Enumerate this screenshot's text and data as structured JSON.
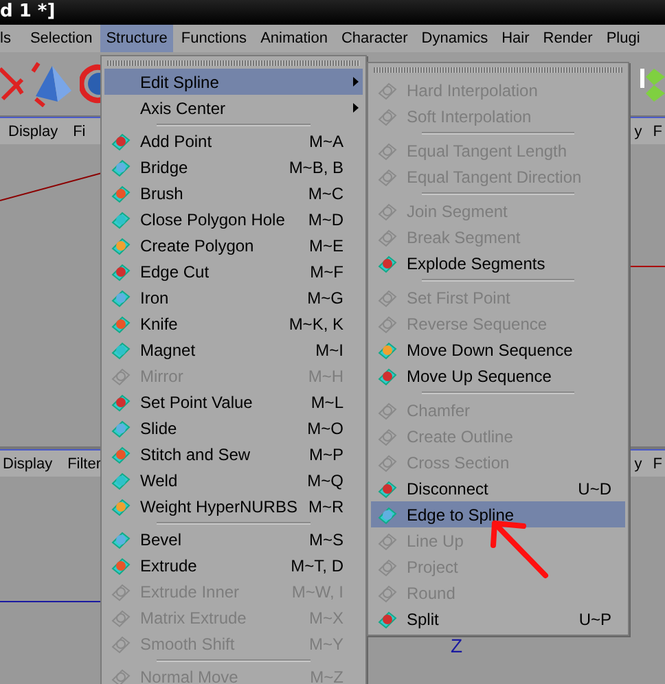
{
  "window": {
    "title": "d 1 *]"
  },
  "menubar": [
    {
      "label": "ls",
      "selected": false
    },
    {
      "label": "Selection",
      "selected": false
    },
    {
      "label": "Structure",
      "selected": true
    },
    {
      "label": "Functions",
      "selected": false
    },
    {
      "label": "Animation",
      "selected": false
    },
    {
      "label": "Character",
      "selected": false
    },
    {
      "label": "Dynamics",
      "selected": false
    },
    {
      "label": "Hair",
      "selected": false
    },
    {
      "label": "Render",
      "selected": false
    },
    {
      "label": "Plugi",
      "selected": false
    }
  ],
  "viewports": [
    {
      "tabs": [
        "Display",
        "Fi"
      ]
    },
    {
      "tabs": [
        "y",
        "F"
      ]
    },
    {
      "tabs": [
        "Display",
        "Filter"
      ]
    },
    {
      "tabs": [
        "y",
        "F"
      ],
      "axis_label": "Z"
    }
  ],
  "menu": {
    "items": [
      {
        "kind": "item",
        "label": "Edit Spline",
        "selected": true,
        "disabled": false,
        "has_submenu": true
      },
      {
        "kind": "item",
        "label": "Axis Center",
        "selected": false,
        "disabled": false,
        "has_submenu": true
      },
      {
        "kind": "separator"
      },
      {
        "kind": "item",
        "label": "Add Point",
        "shortcut": "M~A",
        "selected": false,
        "disabled": false,
        "has_submenu": false
      },
      {
        "kind": "item",
        "label": "Bridge",
        "shortcut": "M~B, B",
        "selected": false,
        "disabled": false,
        "has_submenu": false
      },
      {
        "kind": "item",
        "label": "Brush",
        "shortcut": "M~C",
        "selected": false,
        "disabled": false,
        "has_submenu": false
      },
      {
        "kind": "item",
        "label": "Close Polygon Hole",
        "shortcut": "M~D",
        "selected": false,
        "disabled": false,
        "has_submenu": false
      },
      {
        "kind": "item",
        "label": "Create Polygon",
        "shortcut": "M~E",
        "selected": false,
        "disabled": false,
        "has_submenu": false
      },
      {
        "kind": "item",
        "label": "Edge Cut",
        "shortcut": "M~F",
        "selected": false,
        "disabled": false,
        "has_submenu": false
      },
      {
        "kind": "item",
        "label": "Iron",
        "shortcut": "M~G",
        "selected": false,
        "disabled": false,
        "has_submenu": false
      },
      {
        "kind": "item",
        "label": "Knife",
        "shortcut": "M~K, K",
        "selected": false,
        "disabled": false,
        "has_submenu": false
      },
      {
        "kind": "item",
        "label": "Magnet",
        "shortcut": "M~I",
        "selected": false,
        "disabled": false,
        "has_submenu": false
      },
      {
        "kind": "item",
        "label": "Mirror",
        "shortcut": "M~H",
        "selected": false,
        "disabled": true,
        "has_submenu": false
      },
      {
        "kind": "item",
        "label": "Set Point Value",
        "shortcut": "M~L",
        "selected": false,
        "disabled": false,
        "has_submenu": false
      },
      {
        "kind": "item",
        "label": "Slide",
        "shortcut": "M~O",
        "selected": false,
        "disabled": false,
        "has_submenu": false
      },
      {
        "kind": "item",
        "label": "Stitch and Sew",
        "shortcut": "M~P",
        "selected": false,
        "disabled": false,
        "has_submenu": false
      },
      {
        "kind": "item",
        "label": "Weld",
        "shortcut": "M~Q",
        "selected": false,
        "disabled": false,
        "has_submenu": false
      },
      {
        "kind": "item",
        "label": "Weight HyperNURBS",
        "shortcut": "M~R",
        "selected": false,
        "disabled": false,
        "has_submenu": false
      },
      {
        "kind": "separator"
      },
      {
        "kind": "item",
        "label": "Bevel",
        "shortcut": "M~S",
        "selected": false,
        "disabled": false,
        "has_submenu": false
      },
      {
        "kind": "item",
        "label": "Extrude",
        "shortcut": "M~T, D",
        "selected": false,
        "disabled": false,
        "has_submenu": false
      },
      {
        "kind": "item",
        "label": "Extrude Inner",
        "shortcut": "M~W, I",
        "selected": false,
        "disabled": true,
        "has_submenu": false
      },
      {
        "kind": "item",
        "label": "Matrix Extrude",
        "shortcut": "M~X",
        "selected": false,
        "disabled": true,
        "has_submenu": false
      },
      {
        "kind": "item",
        "label": "Smooth Shift",
        "shortcut": "M~Y",
        "selected": false,
        "disabled": true,
        "has_submenu": false
      },
      {
        "kind": "separator"
      },
      {
        "kind": "item",
        "label": "Normal Move",
        "shortcut": "M~Z",
        "selected": false,
        "disabled": true,
        "has_submenu": false
      }
    ]
  },
  "submenu": {
    "items": [
      {
        "kind": "item",
        "label": "Hard Interpolation",
        "selected": false,
        "disabled": true
      },
      {
        "kind": "item",
        "label": "Soft Interpolation",
        "selected": false,
        "disabled": true
      },
      {
        "kind": "separator"
      },
      {
        "kind": "item",
        "label": "Equal Tangent Length",
        "selected": false,
        "disabled": true
      },
      {
        "kind": "item",
        "label": "Equal Tangent Direction",
        "selected": false,
        "disabled": true
      },
      {
        "kind": "separator"
      },
      {
        "kind": "item",
        "label": "Join Segment",
        "selected": false,
        "disabled": true
      },
      {
        "kind": "item",
        "label": "Break Segment",
        "selected": false,
        "disabled": true
      },
      {
        "kind": "item",
        "label": "Explode Segments",
        "selected": false,
        "disabled": false
      },
      {
        "kind": "separator"
      },
      {
        "kind": "item",
        "label": "Set First Point",
        "selected": false,
        "disabled": true
      },
      {
        "kind": "item",
        "label": "Reverse Sequence",
        "selected": false,
        "disabled": true
      },
      {
        "kind": "item",
        "label": "Move Down Sequence",
        "selected": false,
        "disabled": false
      },
      {
        "kind": "item",
        "label": "Move Up Sequence",
        "selected": false,
        "disabled": false
      },
      {
        "kind": "separator"
      },
      {
        "kind": "item",
        "label": "Chamfer",
        "selected": false,
        "disabled": true
      },
      {
        "kind": "item",
        "label": "Create Outline",
        "selected": false,
        "disabled": true
      },
      {
        "kind": "item",
        "label": "Cross Section",
        "selected": false,
        "disabled": true
      },
      {
        "kind": "item",
        "label": "Disconnect",
        "shortcut": "U~D",
        "selected": false,
        "disabled": false
      },
      {
        "kind": "item",
        "label": "Edge to Spline",
        "selected": true,
        "disabled": false
      },
      {
        "kind": "item",
        "label": "Line Up",
        "selected": false,
        "disabled": true
      },
      {
        "kind": "item",
        "label": "Project",
        "selected": false,
        "disabled": true
      },
      {
        "kind": "item",
        "label": "Round",
        "selected": false,
        "disabled": true
      },
      {
        "kind": "item",
        "label": "Split",
        "shortcut": "U~P",
        "selected": false,
        "disabled": false
      }
    ]
  }
}
